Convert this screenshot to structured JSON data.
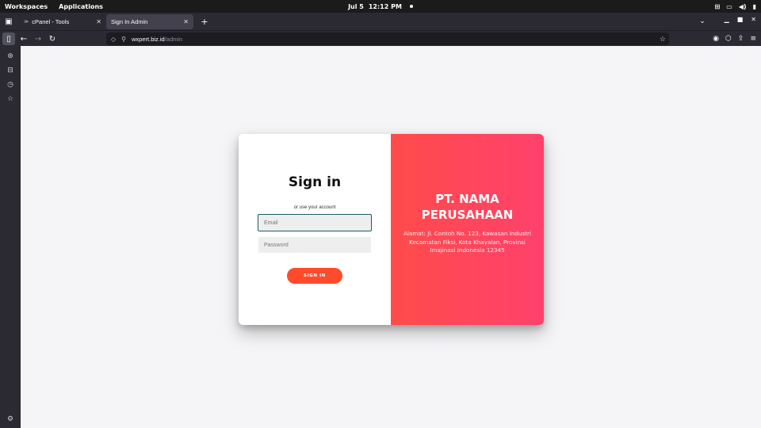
{
  "os_bar": {
    "workspaces": "Workspaces",
    "applications": "Applications",
    "date": "Jul 5",
    "time": "12:12 PM"
  },
  "tabs": [
    {
      "label": "cPanel - Tools",
      "active": false
    },
    {
      "label": "Sign In Admin",
      "active": true
    }
  ],
  "url": {
    "host": "wxpert.biz.id",
    "path": "/admin"
  },
  "login": {
    "title": "Sign in",
    "subtitle": "or use your account",
    "email_placeholder": "Email",
    "password_placeholder": "Password",
    "button_label": "SIGN IN"
  },
  "company_panel": {
    "name_line1": "PT. NAMA",
    "name_line2": "PERUSAHAAN",
    "address": "Alamat: Jl. Contoh No. 123, Kawasan Industri Kecamatan Fiksi, Kota Khayalan, Provinsi Imajinasi Indonesia 12345"
  },
  "colors": {
    "accent": "#ff4b2b",
    "panel_gradient_start": "#ff4b4b",
    "panel_gradient_end": "#ff416c"
  }
}
